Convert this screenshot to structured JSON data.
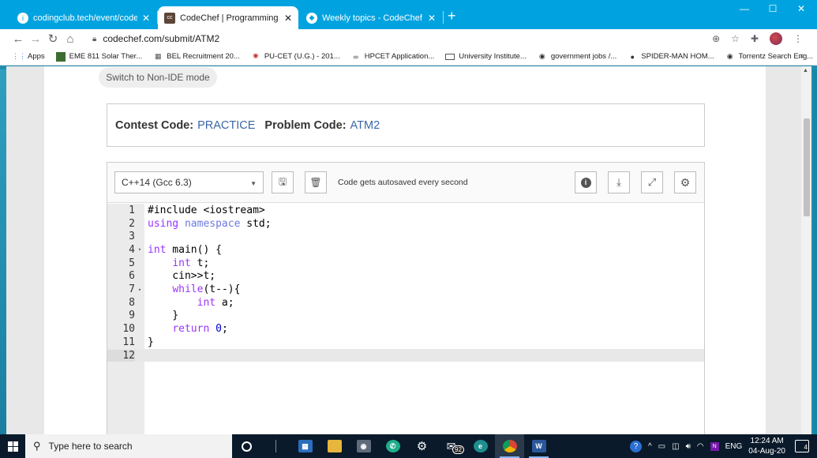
{
  "browser": {
    "tabs": [
      {
        "title": "codingclub.tech/event/codechef",
        "favicon": "info-icon",
        "active": false
      },
      {
        "title": "CodeChef | Programming Compe",
        "favicon": "codechef-icon",
        "active": true
      },
      {
        "title": "Weekly topics - CodeChef Discus",
        "favicon": "discuss-icon",
        "active": false
      }
    ],
    "new_tab": "+",
    "url": "codechef.com/submit/ATM2",
    "window_controls": {
      "minimize": "—",
      "maximize": "☐",
      "close": "✕"
    }
  },
  "bookmarks": [
    {
      "label": "Apps",
      "icon": "apps-grid-icon"
    },
    {
      "label": "EME 811 Solar Ther...",
      "icon": "bookmark-icon"
    },
    {
      "label": "BEL Recruitment 20...",
      "icon": "bookmark-icon"
    },
    {
      "label": "PU-CET (U.G.) - 201...",
      "icon": "bookmark-icon"
    },
    {
      "label": "HPCET Application...",
      "icon": "bookmark-icon"
    },
    {
      "label": "University Institute...",
      "icon": "bookmark-icon"
    },
    {
      "label": "government jobs /...",
      "icon": "globe-icon"
    },
    {
      "label": "SPIDER-MAN HOM...",
      "icon": "bookmark-icon"
    },
    {
      "label": "Torrentz Search Eng...",
      "icon": "globe-icon"
    }
  ],
  "page": {
    "switch_button": "Switch to Non-IDE mode",
    "contest_code_label": "Contest Code:",
    "contest_code_value": "PRACTICE",
    "problem_code_label": "Problem Code:",
    "problem_code_value": "ATM2"
  },
  "editor": {
    "language": "C++14 (Gcc 6.3)",
    "autosave_text": "Code gets autosaved every second",
    "lines": [
      {
        "n": "1",
        "fold": false
      },
      {
        "n": "2",
        "fold": false
      },
      {
        "n": "3",
        "fold": false
      },
      {
        "n": "4",
        "fold": true
      },
      {
        "n": "5",
        "fold": false
      },
      {
        "n": "6",
        "fold": false
      },
      {
        "n": "7",
        "fold": true
      },
      {
        "n": "8",
        "fold": false
      },
      {
        "n": "9",
        "fold": false
      },
      {
        "n": "10",
        "fold": false
      },
      {
        "n": "11",
        "fold": false
      },
      {
        "n": "12",
        "fold": false
      }
    ],
    "code": {
      "l1a": "#include ",
      "l1b": "<iostream>",
      "l2a": "using",
      "l2b": " ",
      "l2c": "namespace",
      "l2d": " std;",
      "l4a": "int",
      "l4b": " main() {",
      "l5a": "    ",
      "l5b": "int",
      "l5c": " t;",
      "l6": "    cin>>t;",
      "l7a": "    ",
      "l7b": "while",
      "l7c": "(t--){",
      "l8a": "        ",
      "l8b": "int",
      "l8c": " a;",
      "l9": "    }",
      "l10a": "    ",
      "l10b": "return",
      "l10c": " ",
      "l10d": "0",
      "l10e": ";",
      "l11": "}"
    }
  },
  "taskbar": {
    "search_placeholder": "Type here to search",
    "mail_badge": "92",
    "language": "ENG",
    "time": "12:24 AM",
    "date": "04-Aug-20",
    "notifications": "4"
  }
}
